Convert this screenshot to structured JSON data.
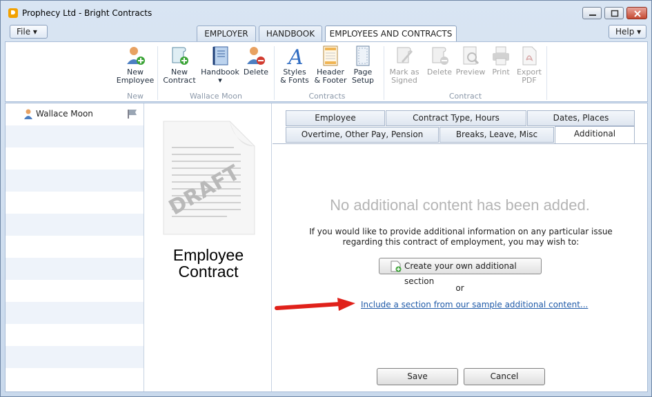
{
  "window": {
    "title": "Prophecy Ltd - Bright Contracts"
  },
  "menu": {
    "file_label": "File ▾",
    "help_label": "Help ▾"
  },
  "main_tabs": [
    {
      "label": "EMPLOYER"
    },
    {
      "label": "HANDBOOK"
    },
    {
      "label": "EMPLOYEES AND CONTRACTS"
    }
  ],
  "ribbon": {
    "new_group": {
      "label": "New",
      "new_employee": "New\nEmployee"
    },
    "wallace_group": {
      "label": "Wallace Moon",
      "new_contract": "New\nContract",
      "handbook": "Handbook\n▾",
      "delete": "Delete"
    },
    "contracts_group": {
      "label": "Contracts",
      "styles_fonts": "Styles\n& Fonts",
      "header_footer": "Header\n& Footer",
      "page_setup": "Page\nSetup"
    },
    "contract_group": {
      "label": "Contract",
      "mark_signed": "Mark as\nSigned",
      "delete": "Delete",
      "preview": "Preview",
      "print": "Print",
      "export_pdf": "Export\nPDF"
    }
  },
  "employees": [
    {
      "name": "Wallace Moon"
    }
  ],
  "document": {
    "caption": "Employee\nContract",
    "watermark": "DRAFT"
  },
  "detail_tabs": {
    "row1": [
      "Employee",
      "Contract Type, Hours",
      "Dates, Places"
    ],
    "row2": [
      "Overtime, Other Pay, Pension",
      "Breaks, Leave, Misc",
      "Additional"
    ]
  },
  "additional": {
    "empty_message": "No additional content has been added.",
    "info": "If you would like to provide additional information on any particular issue regarding this contract of employment, you may wish to:",
    "create_button": "Create your own additional section",
    "or": "or",
    "link": "Include a section from our sample additional content..."
  },
  "buttons": {
    "save": "Save",
    "cancel": "Cancel"
  },
  "colors": {
    "accent": "#1f5aa8",
    "arrow": "#e0211a",
    "disabled": "#9a9a9a"
  }
}
